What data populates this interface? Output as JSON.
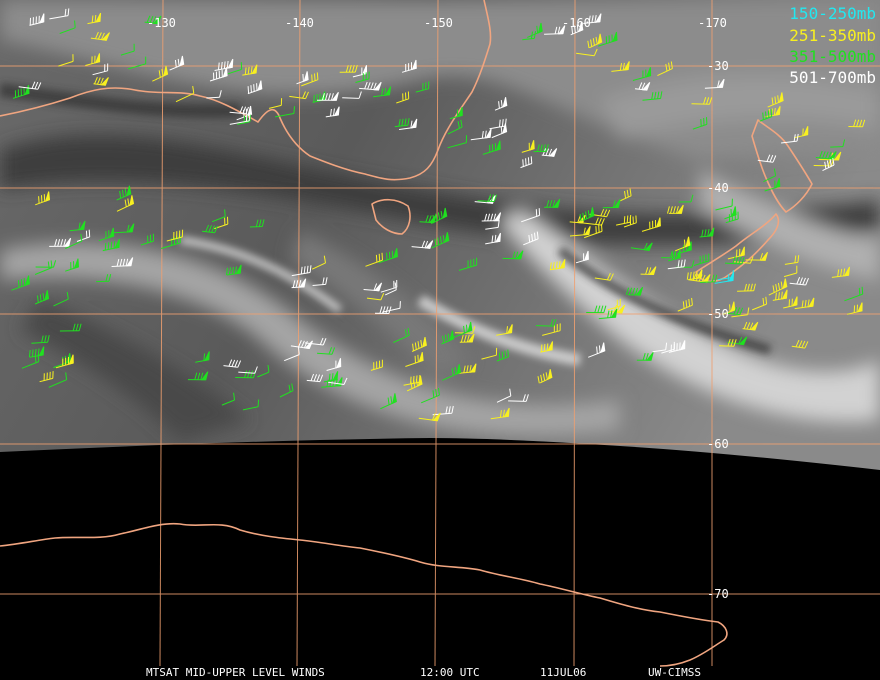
{
  "map": {
    "longitude_labels": [
      "-130",
      "-140",
      "-150",
      "-160",
      "-170"
    ],
    "latitude_labels": [
      "-30",
      "-40",
      "-50",
      "-60",
      "-70"
    ],
    "colors": {
      "graticule": "#f0a070",
      "coastline": "#f0a580",
      "earth_shadow": "#000000",
      "cloud_dark": "#3a3a3a",
      "cloud_light": "#cfcfcf"
    }
  },
  "legend": [
    {
      "label": "150-250mb",
      "color": "#22e8f0"
    },
    {
      "label": "251-350mb",
      "color": "#f8f020"
    },
    {
      "label": "351-500mb",
      "color": "#20e020"
    },
    {
      "label": "501-700mb",
      "color": "#ffffff"
    }
  ],
  "footer": {
    "product": "MTSAT MID-UPPER LEVEL WINDS",
    "time": "12:00 UTC",
    "date": "11JUL06",
    "source": "UW-CIMSS"
  }
}
